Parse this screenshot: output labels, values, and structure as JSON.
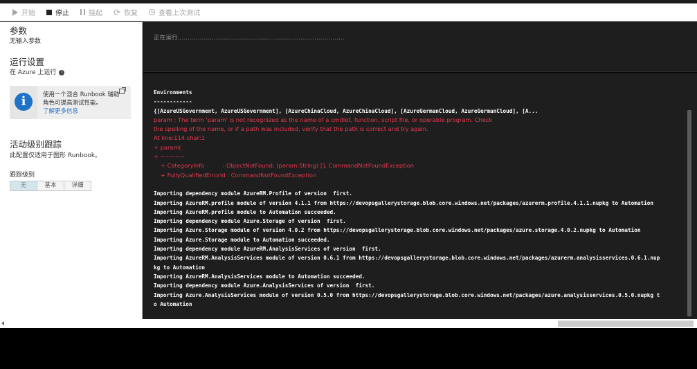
{
  "toolbar": {
    "start": "开始",
    "stop": "停止",
    "pause": "挂起",
    "resume": "恢复",
    "last_test": "查看上次测试"
  },
  "left": {
    "params_title": "参数",
    "params_sub": "无输入参数",
    "run_title": "运行设置",
    "run_sub": "在 Azure 上运行",
    "info_text": "使用一个混合 Runbook 辅助角色可提高测试性能。",
    "info_link": "了解更多信息",
    "trace_title": "活动级别跟踪",
    "trace_sub": "此配置仅适用于图形 Runbook。",
    "trace_level_label": "跟踪级别",
    "levels": [
      "无",
      "基本",
      "详细"
    ],
    "selected_level": "无"
  },
  "console": {
    "status": "正在运行...................................................................................",
    "lines": [
      {
        "text": "Environments",
        "style": "normal"
      },
      {
        "text": "------------",
        "style": "normal"
      },
      {
        "text": "{[AzureUSGovernment, AzureUSGovernment], [AzureChinaCloud, AzureChinaCloud], [AzureGermanCloud, AzureGermanCloud], [A...",
        "style": "normal"
      },
      {
        "text": "param : The term 'param' is not recognized as the name of a cmdlet, function, script file, or operable program. Check",
        "style": "err"
      },
      {
        "text": "the spelling of the name, or if a path was included, verify that the path is correct and try again.",
        "style": "err"
      },
      {
        "text": "At line:114 char:1",
        "style": "err"
      },
      {
        "text": "+ param(",
        "style": "err"
      },
      {
        "text": "+ ~~~~~",
        "style": "err"
      },
      {
        "text": "+ CategoryInfo          : ObjectNotFound: (param:String) [], CommandNotFoundException",
        "style": "err-indent"
      },
      {
        "text": "+ FullyQualifiedErrorId : CommandNotFoundException",
        "style": "err-indent"
      },
      {
        "text": "",
        "style": "normal"
      },
      {
        "text": "Importing dependency module AzureRM.Profile of version  first.",
        "style": "normal"
      },
      {
        "text": "Importing AzureRM.profile module of version 4.1.1 from https://devopsgallerystorage.blob.core.windows.net/packages/azurerm.profile.4.1.1.nupkg to Automation",
        "style": "normal"
      },
      {
        "text": "Importing AzureRM.profile module to Automation succeeded.",
        "style": "normal"
      },
      {
        "text": "Importing dependency module Azure.Storage of version  first.",
        "style": "normal"
      },
      {
        "text": "Importing Azure.Storage module of version 4.0.2 from https://devopsgallerystorage.blob.core.windows.net/packages/azure.storage.4.0.2.nupkg to Automation",
        "style": "normal"
      },
      {
        "text": "Importing Azure.Storage module to Automation succeeded.",
        "style": "normal"
      },
      {
        "text": "Importing dependency module AzureRM.AnalysisServices of version  first.",
        "style": "normal"
      },
      {
        "text": "Importing AzureRM.AnalysisServices module of version 0.6.1 from https://devopsgallerystorage.blob.core.windows.net/packages/azurerm.analysisservices.0.6.1.nup",
        "style": "normal"
      },
      {
        "text": "kg to Automation",
        "style": "normal"
      },
      {
        "text": "Importing AzureRM.AnalysisServices module to Automation succeeded.",
        "style": "normal"
      },
      {
        "text": "Importing dependency module Azure.AnalysisServices of version  first.",
        "style": "normal"
      },
      {
        "text": "Importing Azure.AnalysisServices module of version 0.5.0 from https://devopsgallerystorage.blob.core.windows.net/packages/azure.analysisservices.0.5.0.nupkg t",
        "style": "normal"
      },
      {
        "text": "o Automation",
        "style": "normal"
      }
    ]
  },
  "colors": {
    "error_text": "#e8384f",
    "info_icon": "#1e72c8",
    "console_bg": "#1e1e1e"
  }
}
